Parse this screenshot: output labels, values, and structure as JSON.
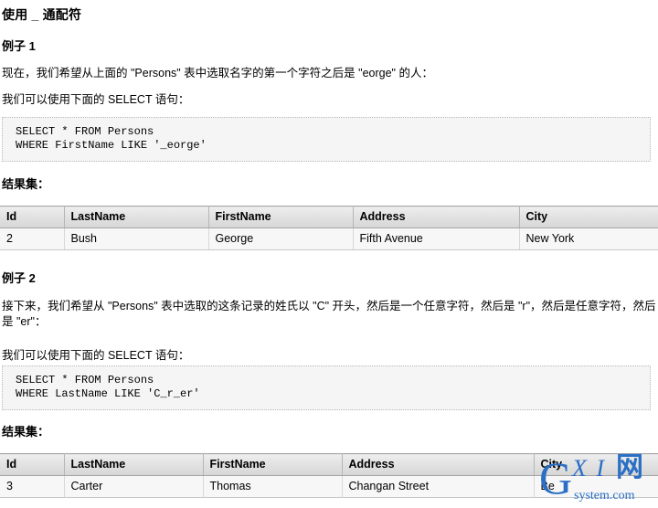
{
  "document": {
    "title": "使用 _ 通配符"
  },
  "examples": [
    {
      "heading": "例子 1",
      "intro": "现在，我们希望从上面的 \"Persons\" 表中选取名字的第一个字符之后是 \"eorge\" 的人：",
      "lead": "我们可以使用下面的 SELECT 语句：",
      "code": "SELECT * FROM Persons\nWHERE FirstName LIKE '_eorge'",
      "result_label": "结果集：",
      "table": {
        "columns": [
          "Id",
          "LastName",
          "FirstName",
          "Address",
          "City"
        ],
        "rows": [
          [
            "2",
            "Bush",
            "George",
            "Fifth Avenue",
            "New York"
          ]
        ]
      }
    },
    {
      "heading": "例子 2",
      "intro": "接下来，我们希望从 \"Persons\" 表中选取的这条记录的姓氏以 \"C\" 开头，然后是一个任意字符，然后是 \"r\"，然后是任意字符，然后是 \"er\"：",
      "lead": "我们可以使用下面的 SELECT 语句：",
      "code": "SELECT * FROM Persons\nWHERE LastName LIKE 'C_r_er'",
      "result_label": "结果集：",
      "table": {
        "columns": [
          "Id",
          "LastName",
          "FirstName",
          "Address",
          "City"
        ],
        "rows": [
          [
            "3",
            "Carter",
            "Thomas",
            "Changan Street",
            "Be"
          ]
        ]
      }
    }
  ],
  "watermark": {
    "g": "G",
    "xi": "X I",
    "net": "网",
    "sub": "system.com",
    "color": "#2a6fc4"
  }
}
